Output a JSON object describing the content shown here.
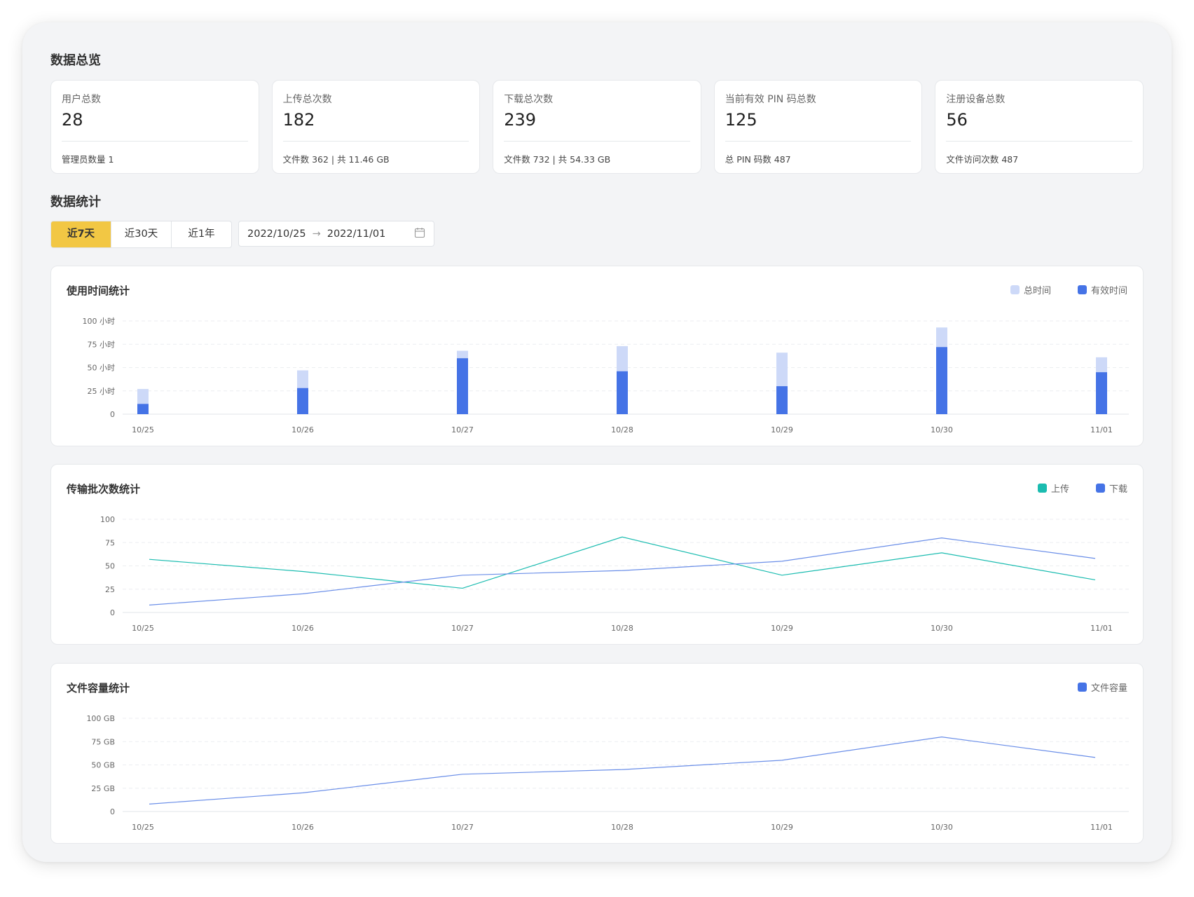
{
  "overview": {
    "title": "数据总览",
    "cards": [
      {
        "label": "用户总数",
        "value": "28",
        "foot": "管理员数量  1"
      },
      {
        "label": "上传总次数",
        "value": "182",
        "foot": "文件数  362  | 共 11.46 GB"
      },
      {
        "label": "下载总次数",
        "value": "239",
        "foot": "文件数  732  |  共 54.33 GB"
      },
      {
        "label": "当前有效 PIN 码总数",
        "value": "125",
        "foot": "总 PIN 码数  487"
      },
      {
        "label": "注册设备总数",
        "value": "56",
        "foot": "文件访问次数  487"
      }
    ]
  },
  "stats": {
    "title": "数据统计",
    "ranges": [
      "近7天",
      "近30天",
      "近1年"
    ],
    "active_range": 0,
    "date_start": "2022/10/25",
    "date_arrow": "→",
    "date_end": "2022/11/01",
    "calendar_icon": "calendar-icon"
  },
  "colors": {
    "accent": "#f2c744",
    "blue": "#4573e6",
    "light_blue": "#cdd9f8",
    "teal": "#1bbcb0",
    "line_blue": "#6a8ee8"
  },
  "chart_data": [
    {
      "type": "bar",
      "title": "使用时间统计",
      "categories": [
        "10/25",
        "10/26",
        "10/27",
        "10/28",
        "10/29",
        "10/30",
        "11/01"
      ],
      "series": [
        {
          "name": "总时间",
          "values": [
            27,
            47,
            68,
            73,
            66,
            93,
            61
          ]
        },
        {
          "name": "有效时间",
          "values": [
            11,
            28,
            60,
            46,
            30,
            72,
            45
          ]
        }
      ],
      "stacked": "overlap",
      "yticks": [
        "0",
        "25 小时",
        "50 小时",
        "75 小时",
        "100 小时"
      ],
      "ylim": [
        0,
        100
      ],
      "grid": true,
      "legend": "top-right"
    },
    {
      "type": "line",
      "title": "传输批次数统计",
      "categories": [
        "10/25",
        "10/26",
        "10/27",
        "10/28",
        "10/29",
        "10/30",
        "11/01"
      ],
      "series": [
        {
          "name": "上传",
          "values": [
            57,
            44,
            26,
            81,
            40,
            64,
            35
          ]
        },
        {
          "name": "下载",
          "values": [
            8,
            20,
            40,
            45,
            55,
            80,
            58
          ]
        }
      ],
      "yticks": [
        "0",
        "25",
        "50",
        "75",
        "100"
      ],
      "ylim": [
        0,
        100
      ],
      "grid": true,
      "legend": "top-right"
    },
    {
      "type": "line",
      "title": "文件容量统计",
      "categories": [
        "10/25",
        "10/26",
        "10/27",
        "10/28",
        "10/29",
        "10/30",
        "11/01"
      ],
      "series": [
        {
          "name": "文件容量",
          "values": [
            8,
            20,
            40,
            45,
            55,
            80,
            58
          ]
        }
      ],
      "yticks": [
        "0",
        "25 GB",
        "50 GB",
        "75 GB",
        "100 GB"
      ],
      "ylim": [
        0,
        100
      ],
      "grid": true,
      "legend": "top-right"
    }
  ]
}
